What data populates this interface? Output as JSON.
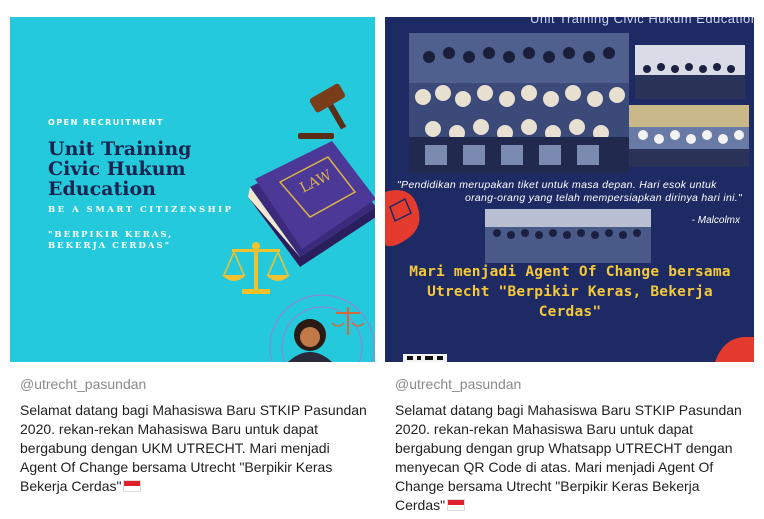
{
  "posts": [
    {
      "handle": "@utrecht_pasundan",
      "caption": "Selamat datang bagi Mahasiswa Baru STKIP Pasundan 2020. rekan-rekan Mahasiswa Baru untuk dapat bergabung dengan UKM UTRECHT. Mari menjadi Agent Of Change bersama Utrecht \"Berpikir Keras Bekerja Cerdas\"",
      "poster": {
        "recruit": "OPEN RECRUITMENT",
        "title": "Unit Training Civic Hukum Education",
        "tagline": "BE A SMART CITIZENSHIP",
        "quote": "\"BERPIKIR KERAS, BEKERJA CERDAS\"",
        "book_label": "LAW",
        "bg_color": "#25c9dc"
      }
    },
    {
      "handle": "@utrecht_pasundan",
      "caption": "Selamat datang bagi Mahasiswa Baru STKIP Pasundan 2020. rekan-rekan Mahasiswa Baru untuk dapat bergabung dengan grup Whatsapp UTRECHT dengan menyecan QR Code di atas. Mari menjadi Agent Of Change bersama Utrecht \"Berpikir Keras Bekerja Cerdas\"",
      "poster": {
        "top_text": "Unit Training Civic Hukum Education",
        "quote_line1": "\"Pendidikan merupakan tiket untuk masa depan. Hari esok untuk",
        "quote_line2": "orang-orang yang telah mempersiapkan dirinya hari ini.\"",
        "author": "- Malcolmx",
        "headline": "Mari menjadi Agent Of Change bersama Utrecht \"Berpikir Keras, Bekerja Cerdas\"",
        "bg_color": "#1d2a63",
        "headline_color": "#f6c93a"
      }
    }
  ]
}
